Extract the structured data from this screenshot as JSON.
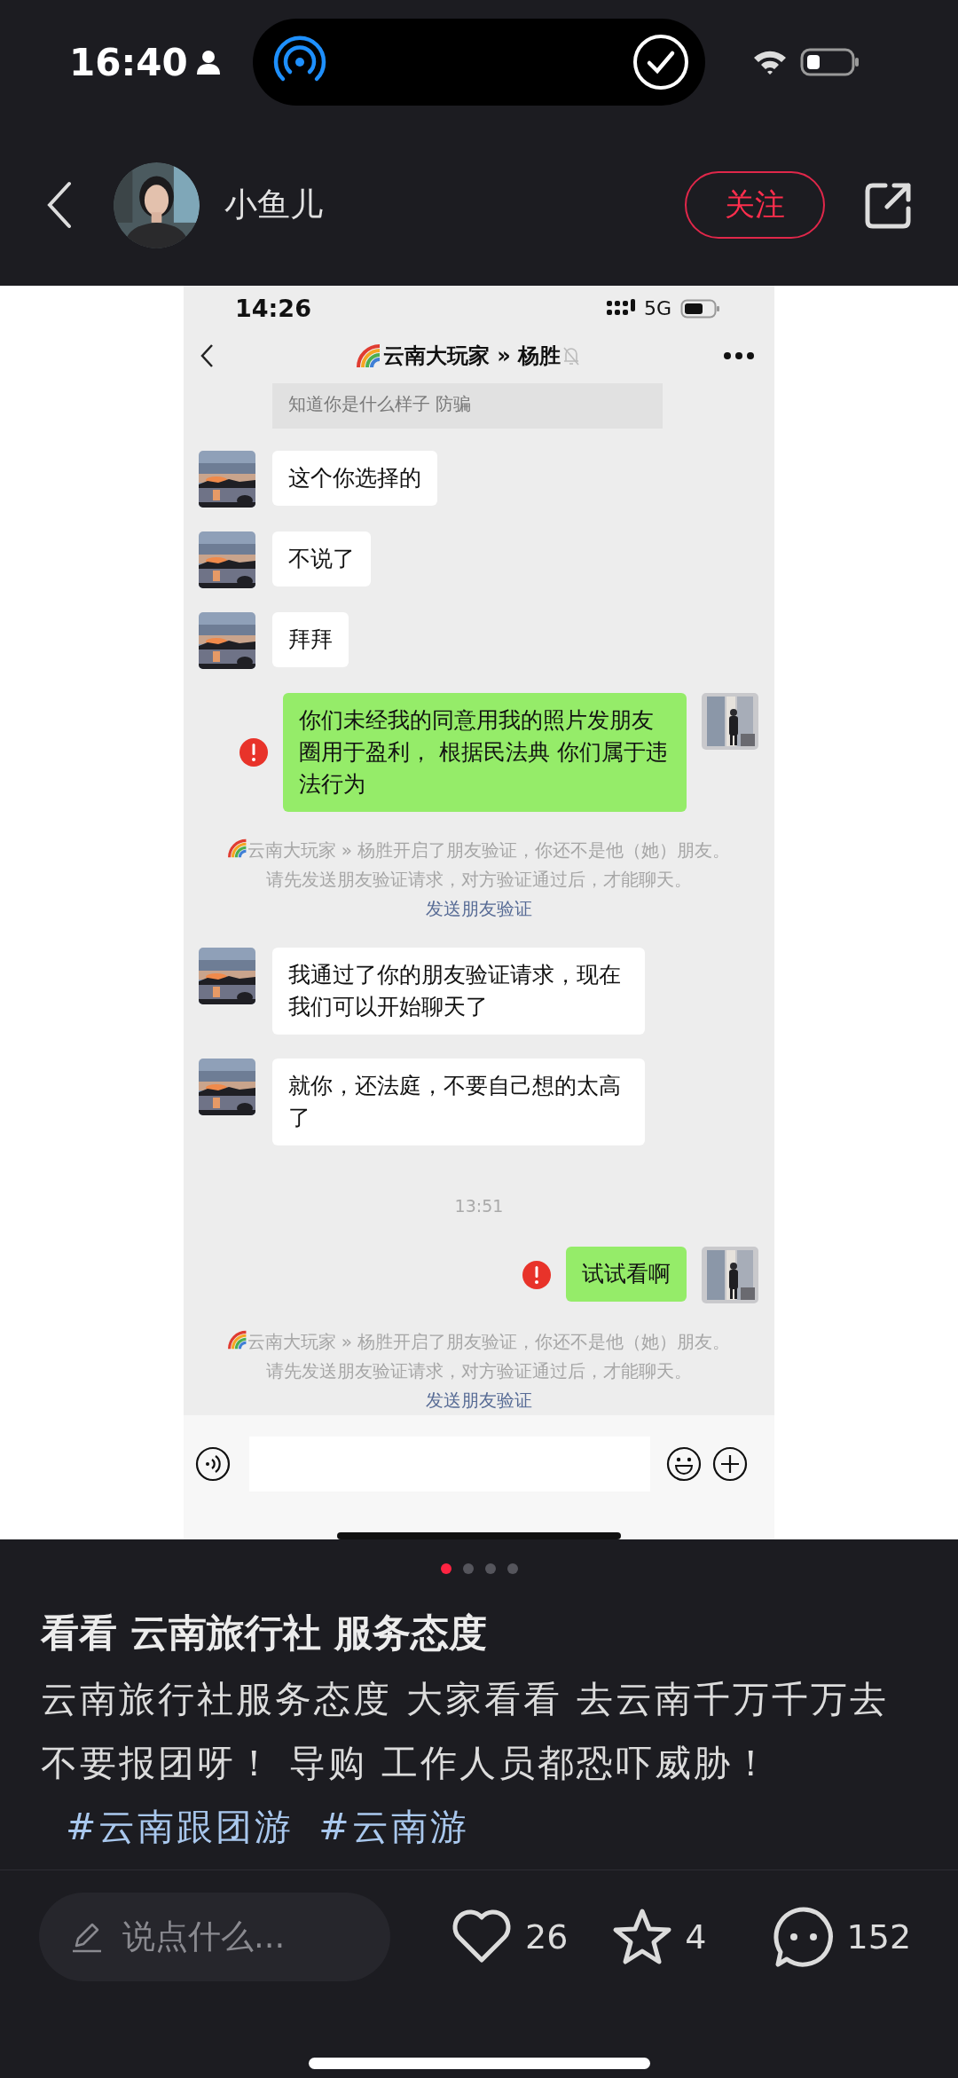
{
  "status_bar": {
    "time": "16:40"
  },
  "header": {
    "user_name": "小鱼儿",
    "follow_button": "关注"
  },
  "post_image": {
    "status_bar": {
      "time": "14:26",
      "network": "5G"
    },
    "chat_title": "云南大玩家 » 杨胜",
    "quoted_text": "知道你是什么样子 防骗",
    "messages": [
      {
        "kind": "received",
        "text": "这个你选择的"
      },
      {
        "kind": "received",
        "text": "不说了"
      },
      {
        "kind": "received",
        "text": "拜拜"
      },
      {
        "kind": "sent",
        "text": "你们未经我的同意用我的照片发朋友圈用于盈利， 根据民法典 你们属于违法行为",
        "failed": true
      },
      {
        "kind": "system",
        "text": "云南大玩家 » 杨胜开启了朋友验证，你还不是他（她）朋友。请先发送朋友验证请求，对方验证通过后，才能聊天。",
        "link": "发送朋友验证"
      },
      {
        "kind": "received",
        "text": "我通过了你的朋友验证请求，现在我们可以开始聊天了"
      },
      {
        "kind": "received",
        "text": "就你，还法庭，不要自己想的太高了"
      },
      {
        "kind": "time",
        "text": "13:51"
      },
      {
        "kind": "sent",
        "text": "试试看啊",
        "failed": true
      },
      {
        "kind": "system",
        "text": "云南大玩家 » 杨胜开启了朋友验证，你还不是他（她）朋友。请先发送朋友验证请求，对方验证通过后，才能聊天。",
        "link": "发送朋友验证"
      }
    ]
  },
  "pager": [
    {
      "selected": true
    },
    {
      "selected": false
    },
    {
      "selected": false
    },
    {
      "selected": false
    }
  ],
  "post": {
    "title": "看看 云南旅行社 服务态度",
    "body": "云南旅行社服务态度 大家看看 去云南千万千万去不要报团呀！ 导购 工作人员都恐吓威胁！",
    "tags": [
      "#云南跟团游",
      "#云南游"
    ]
  },
  "actions": {
    "comment_placeholder": "说点什么...",
    "likes": "26",
    "favorites": "4",
    "comments": "152"
  }
}
